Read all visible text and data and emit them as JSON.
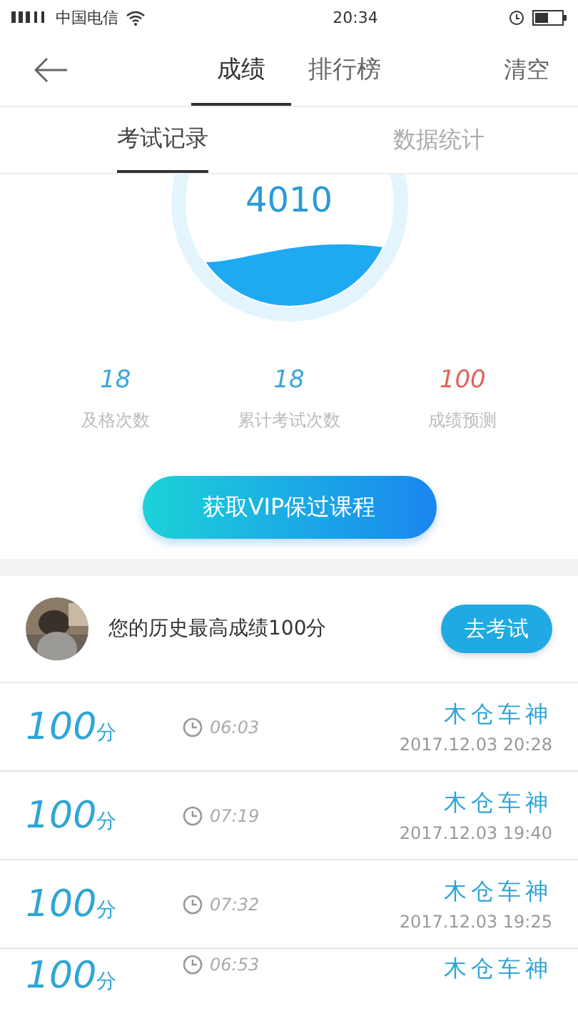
{
  "status_bar": {
    "carrier": "中国电信",
    "time": "20:34"
  },
  "header": {
    "tabs": [
      {
        "label": "成绩",
        "selected": true
      },
      {
        "label": "排行榜",
        "selected": false
      }
    ],
    "action": "清空"
  },
  "subtabs": [
    {
      "label": "考试记录",
      "selected": true
    },
    {
      "label": "数据统计",
      "selected": false
    }
  ],
  "gauge": {
    "value": "4010"
  },
  "stats": [
    {
      "value": "18",
      "label": "及格次数",
      "kind": "normal"
    },
    {
      "value": "18",
      "label": "累计考试次数",
      "kind": "normal"
    },
    {
      "value": "100",
      "label": "成绩预测",
      "kind": "highlight"
    }
  ],
  "vip_button": "获取VIP保过课程",
  "best": {
    "text": "您的历史最高成绩100分",
    "button": "去考试"
  },
  "records": [
    {
      "score": "100",
      "unit": "分",
      "duration": "06:03",
      "name": "木仓车神",
      "date": "2017.12.03  20:28"
    },
    {
      "score": "100",
      "unit": "分",
      "duration": "07:19",
      "name": "木仓车神",
      "date": "2017.12.03  19:40"
    },
    {
      "score": "100",
      "unit": "分",
      "duration": "07:32",
      "name": "木仓车神",
      "date": "2017.12.03  19:25"
    },
    {
      "score": "100",
      "unit": "分",
      "duration": "06:53",
      "name": "木仓车神"
    }
  ]
}
